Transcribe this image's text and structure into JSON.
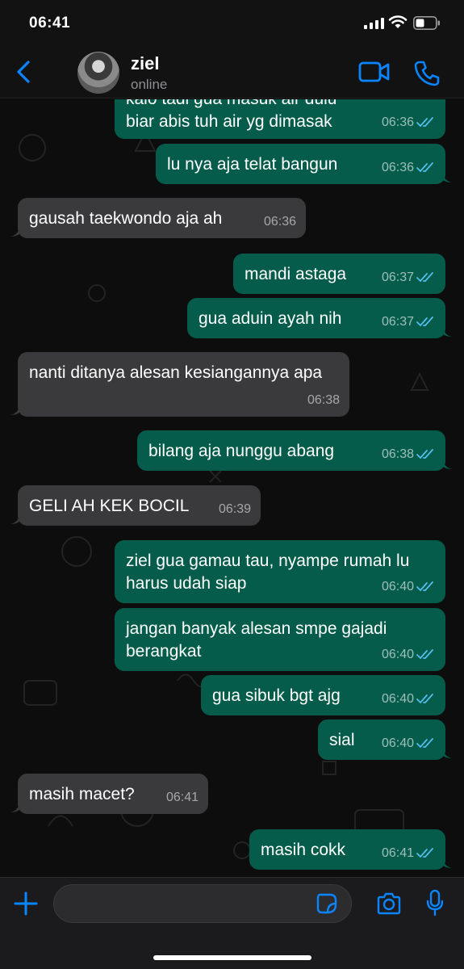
{
  "status_bar": {
    "time": "06:41"
  },
  "header": {
    "contact_name": "ziel",
    "contact_status": "online"
  },
  "messages": [
    {
      "direction": "out",
      "text": "kalo tadi gua masuk air dulu biar abis tuh air yg dimasak",
      "time": "06:36",
      "read": true
    },
    {
      "direction": "out",
      "text": "lu nya aja telat bangun",
      "time": "06:36",
      "read": true
    },
    {
      "direction": "in",
      "text": "gausah taekwondo aja ah",
      "time": "06:36"
    },
    {
      "direction": "out",
      "text": "mandi astaga",
      "time": "06:37",
      "read": true
    },
    {
      "direction": "out",
      "text": "gua aduin ayah nih",
      "time": "06:37",
      "read": true
    },
    {
      "direction": "in",
      "text": "nanti ditanya alesan kesiangannya apa",
      "time": "06:38"
    },
    {
      "direction": "out",
      "text": "bilang aja nunggu abang",
      "time": "06:38",
      "read": true
    },
    {
      "direction": "in",
      "text": "GELI AH KEK BOCIL",
      "time": "06:39"
    },
    {
      "direction": "out",
      "text": "ziel gua gamau tau, nyampe rumah lu harus udah siap",
      "time": "06:40",
      "read": true
    },
    {
      "direction": "out",
      "text": "jangan banyak alesan smpe gajadi berangkat",
      "time": "06:40",
      "read": true
    },
    {
      "direction": "out",
      "text": "gua sibuk bgt ajg",
      "time": "06:40",
      "read": true
    },
    {
      "direction": "out",
      "text": "sial",
      "time": "06:40",
      "read": true
    },
    {
      "direction": "in",
      "text": "masih macet?",
      "time": "06:41"
    },
    {
      "direction": "out",
      "text": "masih cokk",
      "time": "06:41",
      "read": true
    }
  ],
  "composer": {
    "placeholder": ""
  },
  "colors": {
    "outgoing_bubble": "#055c4b",
    "incoming_bubble": "#3a3a3c",
    "accent": "#0a84ff",
    "read_ticks": "#53bdeb"
  },
  "icons": {
    "back": "chevron-left-icon",
    "video": "video-camera-icon",
    "call": "phone-icon",
    "plus": "plus-icon",
    "sticker": "sticker-icon",
    "camera": "camera-icon",
    "mic": "microphone-icon"
  }
}
